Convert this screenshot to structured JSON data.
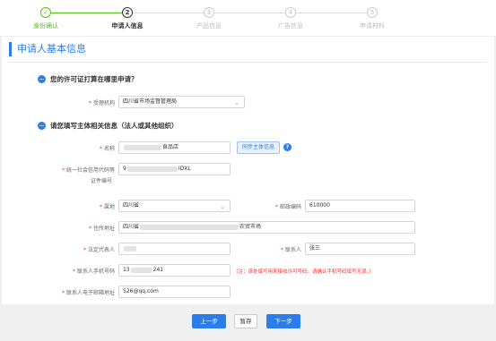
{
  "steps": [
    {
      "num": "✓",
      "label": "身份确认"
    },
    {
      "num": "2",
      "label": "申请人信息"
    },
    {
      "num": "3",
      "label": "产品信息"
    },
    {
      "num": "4",
      "label": "广告信息"
    },
    {
      "num": "5",
      "label": "申请材料"
    }
  ],
  "section_title": "申请人基本信息",
  "question1": "您的许可证打算在哪里申请？",
  "question2": "请您填写主体相关信息（法人或其他组织）",
  "agency": {
    "label": "受理机构",
    "value": "四川省市场监督管理局"
  },
  "name": {
    "label": "名称",
    "value_suffix": "食品店"
  },
  "sync_button": "同步主体信息",
  "credit_code": {
    "label": "统一社会信用代码等",
    "label2": "证件编号",
    "value_prefix": "9",
    "value_suffix": "IDXL"
  },
  "address_area": {
    "label": "属地",
    "value": "四川省"
  },
  "postcode": {
    "label": "邮政编码",
    "value": "610000"
  },
  "residence": {
    "label": "住所地址",
    "value_prefix": "四川省",
    "value_suffix": "农贸市场"
  },
  "legal_rep": {
    "label": "法定代表人"
  },
  "contact": {
    "label": "联系人",
    "value": "张三"
  },
  "contact_phone": {
    "label": "联系人手机号码",
    "value_prefix": "13",
    "value_suffix": "241"
  },
  "phone_note": "（注：该处填写用来接收许可号码，请确认手机号码填写无误。）",
  "contact_email": {
    "label": "联系人电子邮箱地址",
    "value": "526@qq.com"
  },
  "buttons": {
    "prev": "上一步",
    "save": "暂存",
    "next": "下一步"
  }
}
